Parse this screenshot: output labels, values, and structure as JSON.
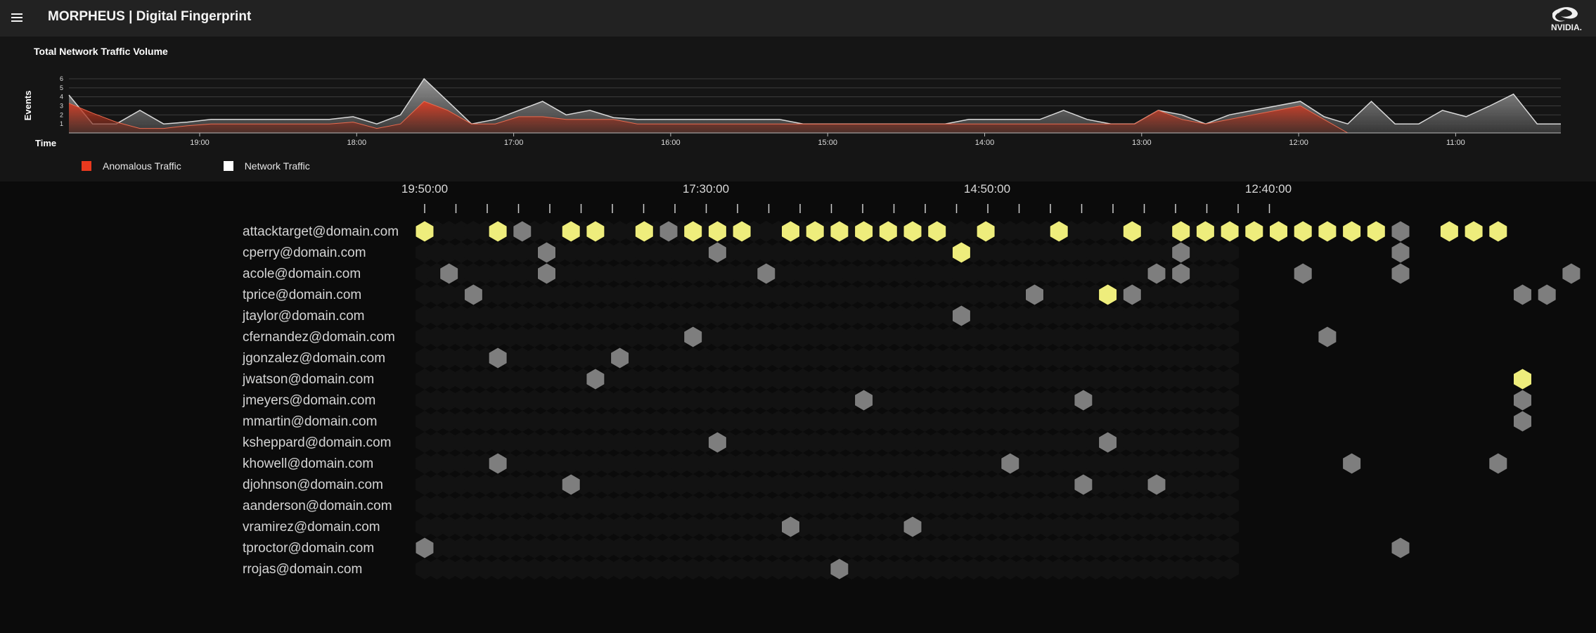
{
  "header": {
    "title": "MORPHEUS | Digital Fingerprint",
    "logo_text": "NVIDIA."
  },
  "colors": {
    "anomalous": "#e8391e",
    "network": "#ffffff",
    "highlight": "#eeed7c",
    "event": "#7e7e7e",
    "empty_cell": "#121212"
  },
  "traffic_panel": {
    "title": "Total Network Traffic Volume",
    "y_label": "Events",
    "x_label": "Time",
    "legend": [
      {
        "label": "Anomalous Traffic",
        "color": "#e8391e"
      },
      {
        "label": "Network Traffic",
        "color": "#ffffff"
      }
    ]
  },
  "chart_data": {
    "type": "area",
    "title": "Total Network Traffic Volume",
    "ylabel": "Events",
    "xlabel": "Time",
    "ylim": [
      0,
      6
    ],
    "ytick_labels": [
      "1",
      "2",
      "3",
      "4",
      "5",
      "6"
    ],
    "xtick_labels": [
      "19:00",
      "18:00",
      "17:00",
      "16:00",
      "15:00",
      "14:00",
      "13:00",
      "12:00",
      "11:00"
    ],
    "series": [
      {
        "name": "Network Traffic",
        "values": [
          4.2,
          1,
          1,
          2.5,
          1,
          1.2,
          1.5,
          1.5,
          1.5,
          1.5,
          1.5,
          1.5,
          1.8,
          1,
          2,
          6,
          3.5,
          1,
          1.5,
          2.5,
          3.5,
          2,
          2.5,
          1.7,
          1.5,
          1.5,
          1.5,
          1.5,
          1.5,
          1.5,
          1.5,
          1,
          1,
          1,
          1,
          1,
          1,
          1,
          1.5,
          1.5,
          1.5,
          1.5,
          2.5,
          1.5,
          1,
          1,
          2.5,
          2,
          1,
          2,
          2.5,
          3,
          3.5,
          1.8,
          1,
          3.5,
          1,
          1,
          2.5,
          1.8,
          3,
          4.3,
          1,
          1
        ]
      },
      {
        "name": "Anomalous Traffic",
        "values": [
          3.3,
          2.2,
          1.2,
          0.5,
          0.5,
          0.8,
          1,
          1,
          1,
          1,
          1,
          1,
          1.2,
          0.5,
          1,
          3.5,
          2.5,
          1,
          1,
          1.8,
          1.8,
          1.5,
          1.5,
          1.5,
          1,
          1,
          1,
          1,
          1,
          1,
          1,
          1,
          1,
          1,
          1,
          1,
          1,
          1,
          1,
          1,
          1,
          1,
          1,
          1,
          1,
          1,
          2.5,
          1.5,
          1,
          1.5,
          2,
          2.5,
          3,
          1.5,
          0,
          0,
          0,
          0,
          0,
          0,
          0,
          0,
          0,
          0
        ]
      }
    ]
  },
  "fingerprint": {
    "time_labels": [
      "19:50:00",
      "17:30:00",
      "14:50:00",
      "12:40:00"
    ],
    "users": [
      {
        "email": "attacktarget@domain.com",
        "events": [
          [
            0,
            2
          ],
          [
            3,
            2
          ],
          [
            4,
            1
          ],
          [
            6,
            2
          ],
          [
            7,
            2
          ],
          [
            9,
            2
          ],
          [
            10,
            1
          ],
          [
            11,
            2
          ],
          [
            12,
            2
          ],
          [
            13,
            2
          ],
          [
            15,
            2
          ],
          [
            16,
            2
          ],
          [
            17,
            2
          ],
          [
            18,
            2
          ],
          [
            19,
            2
          ],
          [
            20,
            2
          ],
          [
            21,
            2
          ],
          [
            23,
            2
          ],
          [
            26,
            2
          ],
          [
            29,
            2
          ],
          [
            31,
            2
          ],
          [
            32,
            2
          ],
          [
            33,
            2
          ],
          [
            34,
            2
          ],
          [
            35,
            2
          ],
          [
            36,
            2
          ],
          [
            37,
            2
          ],
          [
            38,
            2
          ],
          [
            39,
            2
          ],
          [
            40,
            1
          ],
          [
            42,
            2
          ],
          [
            43,
            2
          ],
          [
            44,
            2
          ]
        ]
      },
      {
        "email": "cperry@domain.com",
        "events": [
          [
            5,
            1
          ],
          [
            12,
            1
          ],
          [
            22,
            2
          ],
          [
            31,
            1
          ],
          [
            40,
            1
          ]
        ]
      },
      {
        "email": "acole@domain.com",
        "events": [
          [
            1,
            1
          ],
          [
            5,
            1
          ],
          [
            14,
            1
          ],
          [
            30,
            1
          ],
          [
            31,
            1
          ],
          [
            36,
            1
          ],
          [
            40,
            1
          ],
          [
            47,
            1
          ]
        ]
      },
      {
        "email": "tprice@domain.com",
        "events": [
          [
            2,
            1
          ],
          [
            25,
            1
          ],
          [
            28,
            2
          ],
          [
            29,
            1
          ],
          [
            45,
            1
          ],
          [
            46,
            1
          ]
        ]
      },
      {
        "email": "jtaylor@domain.com",
        "events": [
          [
            22,
            1
          ]
        ]
      },
      {
        "email": "cfernandez@domain.com",
        "events": [
          [
            11,
            1
          ],
          [
            37,
            1
          ]
        ]
      },
      {
        "email": "jgonzalez@domain.com",
        "events": [
          [
            3,
            1
          ],
          [
            8,
            1
          ]
        ]
      },
      {
        "email": "jwatson@domain.com",
        "events": [
          [
            7,
            1
          ],
          [
            45,
            2
          ]
        ]
      },
      {
        "email": "jmeyers@domain.com",
        "events": [
          [
            18,
            1
          ],
          [
            27,
            1
          ],
          [
            45,
            1
          ]
        ]
      },
      {
        "email": "mmartin@domain.com",
        "events": [
          [
            45,
            1
          ]
        ]
      },
      {
        "email": "ksheppard@domain.com",
        "events": [
          [
            12,
            1
          ],
          [
            28,
            1
          ]
        ]
      },
      {
        "email": "khowell@domain.com",
        "events": [
          [
            3,
            1
          ],
          [
            24,
            1
          ],
          [
            38,
            1
          ],
          [
            44,
            1
          ]
        ]
      },
      {
        "email": "djohnson@domain.com",
        "events": [
          [
            6,
            1
          ],
          [
            27,
            1
          ],
          [
            30,
            1
          ]
        ]
      },
      {
        "email": "aanderson@domain.com",
        "events": []
      },
      {
        "email": "vramirez@domain.com",
        "events": [
          [
            15,
            1
          ],
          [
            20,
            1
          ]
        ]
      },
      {
        "email": "tproctor@domain.com",
        "events": [
          [
            0,
            1
          ],
          [
            40,
            1
          ]
        ]
      },
      {
        "email": "rrojas@domain.com",
        "events": [
          [
            17,
            1
          ]
        ]
      }
    ]
  }
}
